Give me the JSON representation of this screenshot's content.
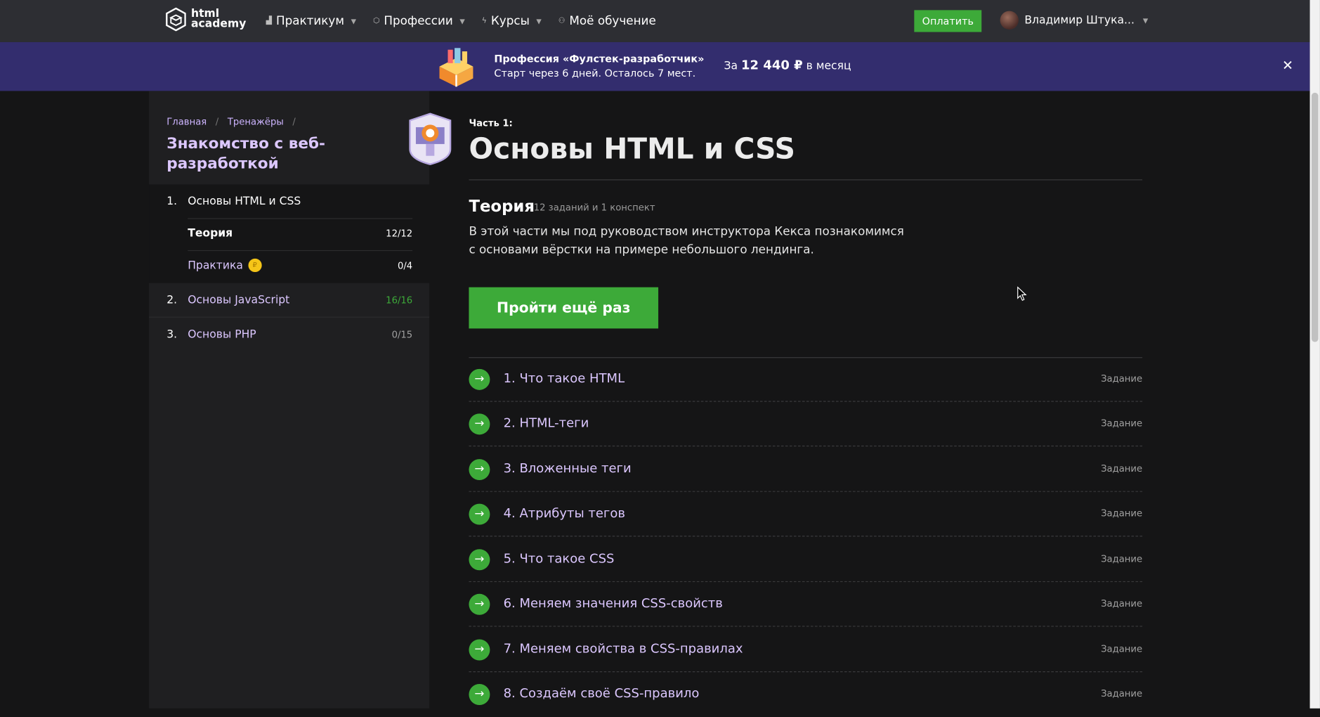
{
  "header": {
    "logo_line1": "html",
    "logo_line2": "academy",
    "nav": [
      {
        "label": "Практикум",
        "icon": "chart-icon"
      },
      {
        "label": "Профессии",
        "icon": "graduation-cap-icon"
      },
      {
        "label": "Курсы",
        "icon": "lightning-icon"
      },
      {
        "label": "Моё обучение",
        "icon": "people-icon"
      }
    ],
    "pay_label": "Оплатить",
    "user_name": "Владимир Штука..."
  },
  "promo": {
    "title": "Профессия «Фулстек-разработчик»",
    "subtitle": "Старт через 6 дней. Осталось 7 мест.",
    "price_prefix": "За",
    "price": "12 440 ₽",
    "price_suffix": "в месяц",
    "close": "✕"
  },
  "sidebar": {
    "breadcrumbs": [
      "Главная",
      "Тренажёры"
    ],
    "course_title": "Знакомство с веб-разработкой",
    "parts": [
      {
        "num": "1.",
        "label": "Основы HTML и CSS"
      },
      {
        "num": "2.",
        "label": "Основы JavaScript",
        "count": "16/16",
        "count_color": "#3daa39"
      },
      {
        "num": "3.",
        "label": "Основы PHP",
        "count": "0/15",
        "count_color": "#a0a0a0"
      }
    ],
    "subitems": [
      {
        "label": "Теория",
        "count": "12/12"
      },
      {
        "label": "Практика",
        "count": "0/4",
        "coin": "₽"
      }
    ]
  },
  "main": {
    "part_label": "Часть 1:",
    "part_title": "Основы HTML и CSS",
    "theory_title": "Теория",
    "theory_meta": "12 заданий и 1 конспект",
    "theory_desc": "В этой части мы под руководством инструктора Кекса познакомимся с основами вёрстки на примере небольшого лендинга.",
    "again_label": "Пройти ещё раз",
    "tasks": [
      {
        "label": "1. Что такое HTML",
        "type": "Задание"
      },
      {
        "label": "2. HTML-теги",
        "type": "Задание"
      },
      {
        "label": "3. Вложенные теги",
        "type": "Задание"
      },
      {
        "label": "4. Атрибуты тегов",
        "type": "Задание"
      },
      {
        "label": "5. Что такое CSS",
        "type": "Задание"
      },
      {
        "label": "6. Меняем значения CSS-свойств",
        "type": "Задание"
      },
      {
        "label": "7. Меняем свойства в CSS-правилах",
        "type": "Задание"
      },
      {
        "label": "8. Создаём своё CSS-правило",
        "type": "Задание"
      }
    ]
  },
  "colors": {
    "accent_green": "#3daa39",
    "promo_bg": "#332d6e",
    "header_bg": "#2d2e33",
    "link_purple": "#dcc7ff"
  }
}
